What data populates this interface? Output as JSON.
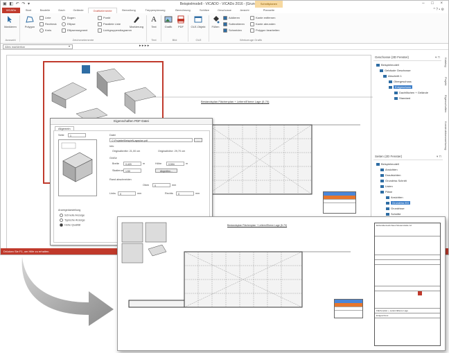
{
  "window": {
    "title": "Beispielmodell - VICADO - VICADo 2016 - [Grundriss EG]",
    "context_tab": "Schnittplanen",
    "context_sub": "Planseite",
    "controls": "– □ ×"
  },
  "tabs": [
    "VICADo",
    "Start",
    "Bauteile",
    "Dach",
    "Gelände",
    "Grafikelemente",
    "Bemaßung",
    "Treppenplanung",
    "Berechnung",
    "Schlitze",
    "Geschosse",
    "Ansicht",
    "Planseite"
  ],
  "ribbon": {
    "marker_label": "Markieren",
    "polygon_label": "Polygon",
    "line_label": "Linie",
    "rect_label": "Rechteck",
    "circle_label": "Kreis",
    "arc_label": "Bogen",
    "ellipse_label": "Ellipse",
    "ellipse_seg_label": "Ellipsensegment",
    "point_label": "Punkt",
    "parallel_label": "Parallele Linie",
    "curve_label": "Lichtgruppendiagramm",
    "hatch_label": "Markierung",
    "text_label": "Text",
    "graphic_label": "Grafik",
    "pdf_label": "PDF",
    "ole_label": "OLE-Objekt",
    "fill_label": "Füllen",
    "add_label": "Addieren",
    "subtract_label": "Subtrahieren",
    "cut_label": "Schneiden",
    "edge_remove_label": "Kante entfernen",
    "edge_split_label": "Kante abrunden",
    "polygon_join_label": "Polygon bearbeiten",
    "group_selection": "Auswahl",
    "group_elements": "Zeichenelemente",
    "group_text": "Text",
    "group_image": "Bild",
    "group_ole": "OLE",
    "group_tools": "Werkzeuge Grafik"
  },
  "addressbar": {
    "combo_value": "Alles markierbar",
    "icons": "▸ ▸ ▸ ▸"
  },
  "statusbar": "Drücken Sie F1, um Hilfe zu erhalten.",
  "panel_floors": {
    "title": "Geschosse (3D Fenster)",
    "items": [
      "Beispielmodell",
      "Gebäude Geschosse",
      "Abschnitt 1",
      "Obergeschoss",
      "Erdgeschoss",
      "Dachflächen + Gelände",
      "Standard"
    ]
  },
  "panel_layers": {
    "title": "Seiten (2D Fenster)",
    "items": [
      "Beispielmodell",
      "Ansichten",
      "Draufsichten",
      "Grundriss Schnitt",
      "Listen",
      "Pläne",
      "Ansichten",
      "Grundriss EG",
      "Grundrisse",
      "Schnitte",
      "Schnitte"
    ]
  },
  "vertical_tabs": [
    "Katalog",
    "Projekt",
    "Eigenschaften",
    "Konstruktionswerkzeug"
  ],
  "dialog": {
    "title": "Eigenschaften PDF-Datei",
    "tab": "Allgemein",
    "page_label": "Seite",
    "page_value": "1",
    "file_label": "Datei",
    "file_value": "C:\\Projekte\\Beispiel\\Lageplan.pdf",
    "info_label": "Info",
    "orig_width_label": "Originalbreite: 21,00 cm",
    "orig_height_label": "Originalhöhe: 29,70 cm",
    "size_label": "Größe",
    "width_label": "Breite",
    "width_value": "0,420",
    "height_label": "Höhe",
    "height_value": "0,594",
    "unit_m": "m",
    "scale_label": "Skalierung",
    "scale_value": "1:50",
    "adopt_button": "Abgreifen...",
    "margin_label": "Rand abschneiden",
    "top_label": "Oben",
    "top_value": "0",
    "left_label": "Links",
    "left_value": "0",
    "right_label": "Rechts",
    "right_value": "0",
    "unit_mm": "mm",
    "display_label": "Anzeigedarstellung",
    "opt_fast": "Schnelle Anzeige",
    "opt_typical": "Typische Anzeige",
    "opt_high": "Hohe Qualität"
  },
  "drawing": {
    "title": "Bestandsplan Flächenplan + Leitern/Ebene Lage (5-70)",
    "overlay_title": "Bestandsplan Flächenplan + Leitern/Ebene Lage (5-70)",
    "block_title": "Einfamilienwohnhaus Musterstraße 12",
    "block_footer": "Erdgeschoss",
    "block_sub": "Flächenplan + Leitern/Ebene Lage"
  },
  "colors": {
    "accent_red": "#c0392b",
    "folder_blue": "#2e6da4",
    "select_blue": "#3d7fc9",
    "legend_blue": "#4a86d9",
    "legend_orange": "#e8762b"
  }
}
